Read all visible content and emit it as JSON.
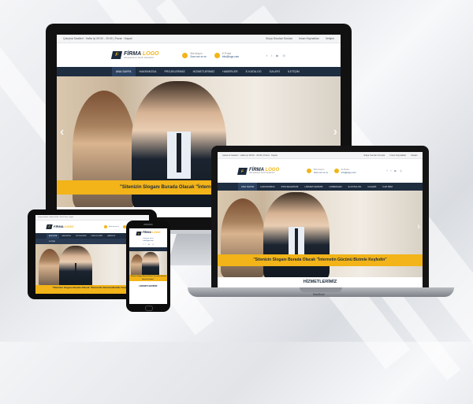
{
  "site": {
    "topbar_hours": "Çalışma Saatleri : Hafta içi 09:00 - 20:00 | Pazar : Kapalı",
    "topbar_links": [
      "Sıkça Sorulan Sorular",
      "İnsan Kaynakları",
      "İletişim"
    ],
    "logo_name": "FİRMA",
    "logo_name_accent": "LOGO",
    "logo_tagline": "Hizmetlerimiz Tercih Sebebiniz",
    "phone_label": "Bizi Arayın",
    "phone_value": "0xxx xxx xx xx",
    "email_label": "E-Posta",
    "email_value": "info@logo.com",
    "social_icons": [
      "facebook-icon",
      "twitter-icon",
      "youtube-icon",
      "instagram-icon"
    ],
    "nav": [
      "ANA SAYFA",
      "HAKKIMIZDA",
      "PROJELERİMİZ",
      "HİZMETLERİMİZ",
      "HABERLER",
      "E-KATALOG",
      "GALERİ",
      "İLETİŞİM"
    ],
    "slogan": "\"Sitenizin Sloganı Burada Olacak \"İnternetin Gücünü Bizimle Keşfedin\"",
    "section_title": "HİZMETLERİMİZ",
    "prev_arrow": "‹",
    "next_arrow": "›"
  },
  "devices": {
    "laptop_brand": "MacBook",
    "imac_logo": ""
  },
  "colors": {
    "accent": "#f2b418",
    "nav_bg": "#1f2d40",
    "brand_dark": "#1d2a3c"
  }
}
